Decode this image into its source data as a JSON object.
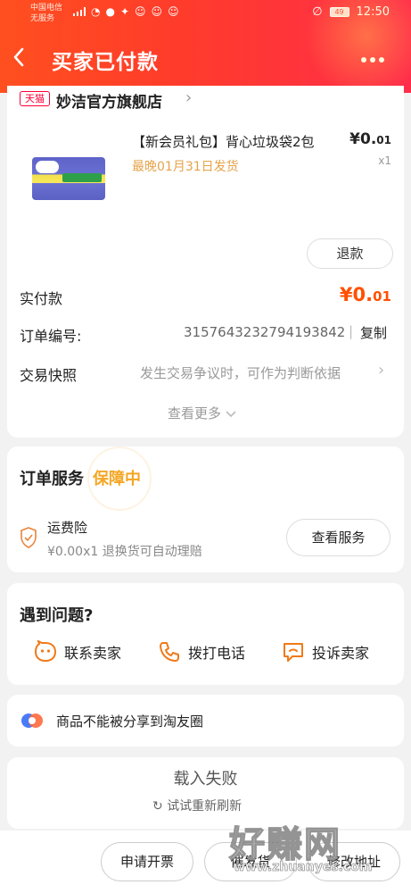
{
  "status_bar": {
    "carrier_line1": "中国电信",
    "carrier_line2": "无服务",
    "battery": "49",
    "time": "12:50"
  },
  "nav": {
    "back_icon": "chevron-left-icon",
    "title": "买家已付款",
    "more_icon": "more-dots-icon"
  },
  "shop": {
    "badge": "天猫",
    "name": "妙洁官方旗舰店"
  },
  "product": {
    "title": "【新会员礼包】背心垃圾袋2包",
    "price_symbol": "¥",
    "price_int": "0.",
    "price_dec": "01",
    "shipping": "最晚01月31日发货",
    "qty": "x1",
    "refund_label": "退款"
  },
  "order": {
    "paid_label": "实付款",
    "paid_symbol": "¥",
    "paid_int": "0.",
    "paid_dec": "01",
    "order_no_label": "订单编号:",
    "order_no": "3157643232794193842",
    "copy_label": "复制",
    "snapshot_label": "交易快照",
    "snapshot_hint": "发生交易争议时，可作为判断依据",
    "see_more": "查看更多"
  },
  "service": {
    "title": "订单服务",
    "tag": "保障中",
    "item_name": "运费险",
    "item_desc": "¥0.00x1 退换货可自动理赔",
    "button": "查看服务"
  },
  "problems": {
    "title": "遇到问题?",
    "items": [
      {
        "label": "联系卖家",
        "icon": "chat-face-icon"
      },
      {
        "label": "拨打电话",
        "icon": "phone-icon"
      },
      {
        "label": "投诉卖家",
        "icon": "complaint-icon"
      }
    ]
  },
  "share": {
    "text": "商品不能被分享到淘友圈"
  },
  "load": {
    "fail_text": "载入失败",
    "retry_text": "试试重新刷新"
  },
  "bottom": {
    "invoice": "申请开票",
    "remind": "催发货",
    "address": "修改地址"
  },
  "watermark": {
    "big": "好赚网",
    "small": "www.zhuanyes.com"
  },
  "colors": {
    "header": "#ff3b2c",
    "price": "#ff5000",
    "accent_gold": "#f5a623",
    "shipping": "#e6a34a"
  }
}
